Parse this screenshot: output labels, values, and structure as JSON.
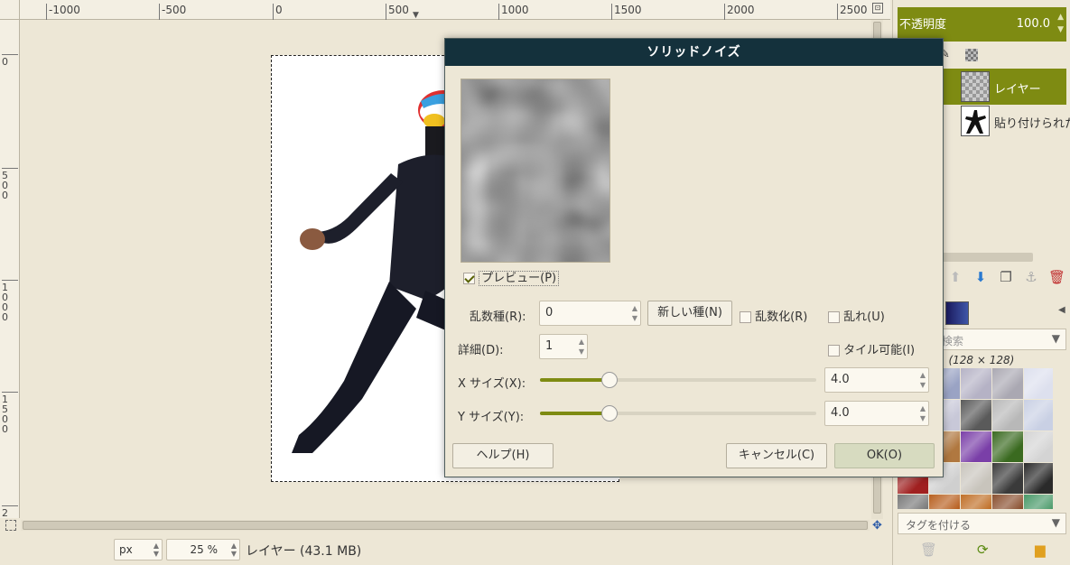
{
  "ruler": {
    "top_ticks": [
      "-1000",
      "-500",
      "0",
      "500",
      "1000",
      "1500",
      "2000",
      "2500"
    ],
    "left_ticks": [
      [
        "0"
      ],
      [
        "5",
        "0",
        "0"
      ],
      [
        "1",
        "0",
        "0",
        "0"
      ],
      [
        "1",
        "5",
        "0",
        "0"
      ],
      [
        "2"
      ]
    ]
  },
  "status": {
    "unit": "px",
    "zoom": "25 %",
    "text": "レイヤー (43.1 MB)"
  },
  "layers_panel": {
    "opacity_label": "不透明度",
    "opacity_value": "100.0",
    "layers": [
      {
        "name": "レイヤー",
        "selected": true
      },
      {
        "name": "貼り付けられた",
        "selected": false
      }
    ]
  },
  "patterns_panel": {
    "search_placeholder": "検索",
    "pattern_info": "1 (128 × 128)",
    "tag_placeholder": "タグを付ける",
    "swatches": [
      "#b9b0a8",
      "#9aa3c4",
      "#b5b2c5",
      "#aaa8b2",
      "#dde0ee",
      "#2a3fb8",
      "#c8c8d8",
      "#5a5a5a",
      "#b8b8b8",
      "#c9d0e4",
      "#8a2a1a",
      "#b07840",
      "#7a3fa8",
      "#3a6a20",
      "#d4d4d4",
      "#a02020",
      "#cfcfcf",
      "#c8c4bc",
      "#3a3a3a",
      "#2a2a2a",
      "#7a7a7a",
      "#b86020",
      "#c07028",
      "#8a5030",
      "#4a9a6a"
    ]
  },
  "dialog": {
    "title": "ソリッドノイズ",
    "preview_label": "プレビュー(P)",
    "preview_checked": true,
    "seed_label": "乱数種(R):",
    "seed_value": "0",
    "new_seed_button": "新しい種(N)",
    "randomize_label": "乱数化(R)",
    "turbulent_label": "乱れ(U)",
    "detail_label": "詳細(D):",
    "detail_value": "1",
    "tileable_label": "タイル可能(I)",
    "xsize_label": "X サイズ(X):",
    "xsize_value": "4.0",
    "xsize_fraction": 0.25,
    "ysize_label": "Y サイズ(Y):",
    "ysize_value": "4.0",
    "ysize_fraction": 0.25,
    "help_button": "ヘルプ(H)",
    "cancel_button": "キャンセル(C)",
    "ok_button": "OK(O)"
  },
  "colors": {
    "accent": "#7e8b12",
    "dialog_title_bg": "#14313c"
  }
}
